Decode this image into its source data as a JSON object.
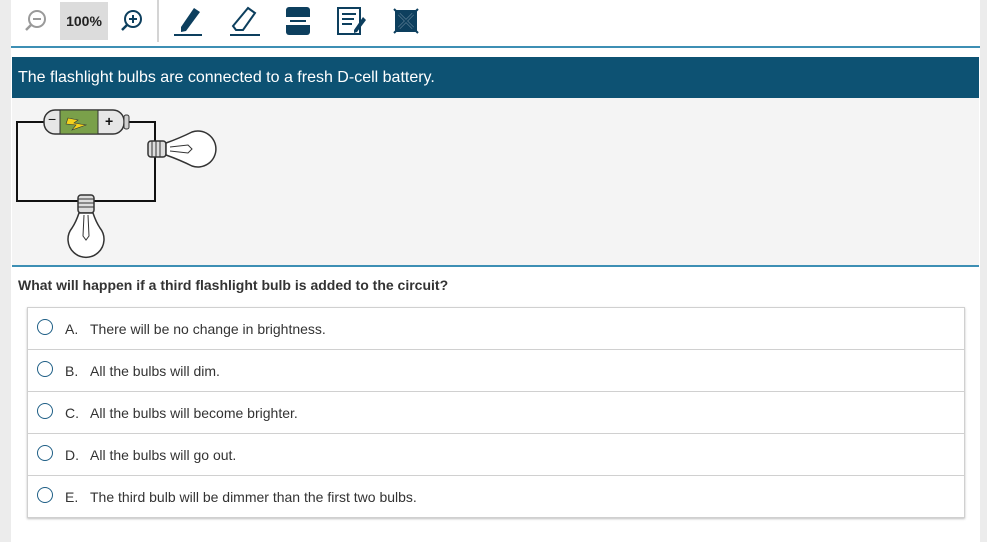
{
  "toolbar": {
    "zoom_level": "100%",
    "icons": [
      "zoom-out-icon",
      "zoom-in-icon",
      "highlighter-icon",
      "eraser-icon",
      "line-reader-icon",
      "notepad-icon",
      "answer-eliminator-icon"
    ]
  },
  "stem": {
    "text": "The flashlight bulbs are connected to a fresh D-cell battery.",
    "figure": {
      "battery_minus": "−",
      "battery_plus": "+"
    }
  },
  "question": "What will happen if a third flashlight bulb is added to the circuit?",
  "options": [
    {
      "letter": "A.",
      "text": "There will be no change in brightness."
    },
    {
      "letter": "B.",
      "text": "All the bulbs will dim."
    },
    {
      "letter": "C.",
      "text": "All the bulbs will become brighter."
    },
    {
      "letter": "D.",
      "text": "All the bulbs will go out."
    },
    {
      "letter": "E.",
      "text": "The third bulb will be dimmer than the first two bulbs."
    }
  ],
  "colors": {
    "header_bg": "#0d5273",
    "accent": "#3d8fb4",
    "radio": "#1f5f86",
    "icon": "#0d3f5e",
    "battery_band": "#7aa04a"
  }
}
